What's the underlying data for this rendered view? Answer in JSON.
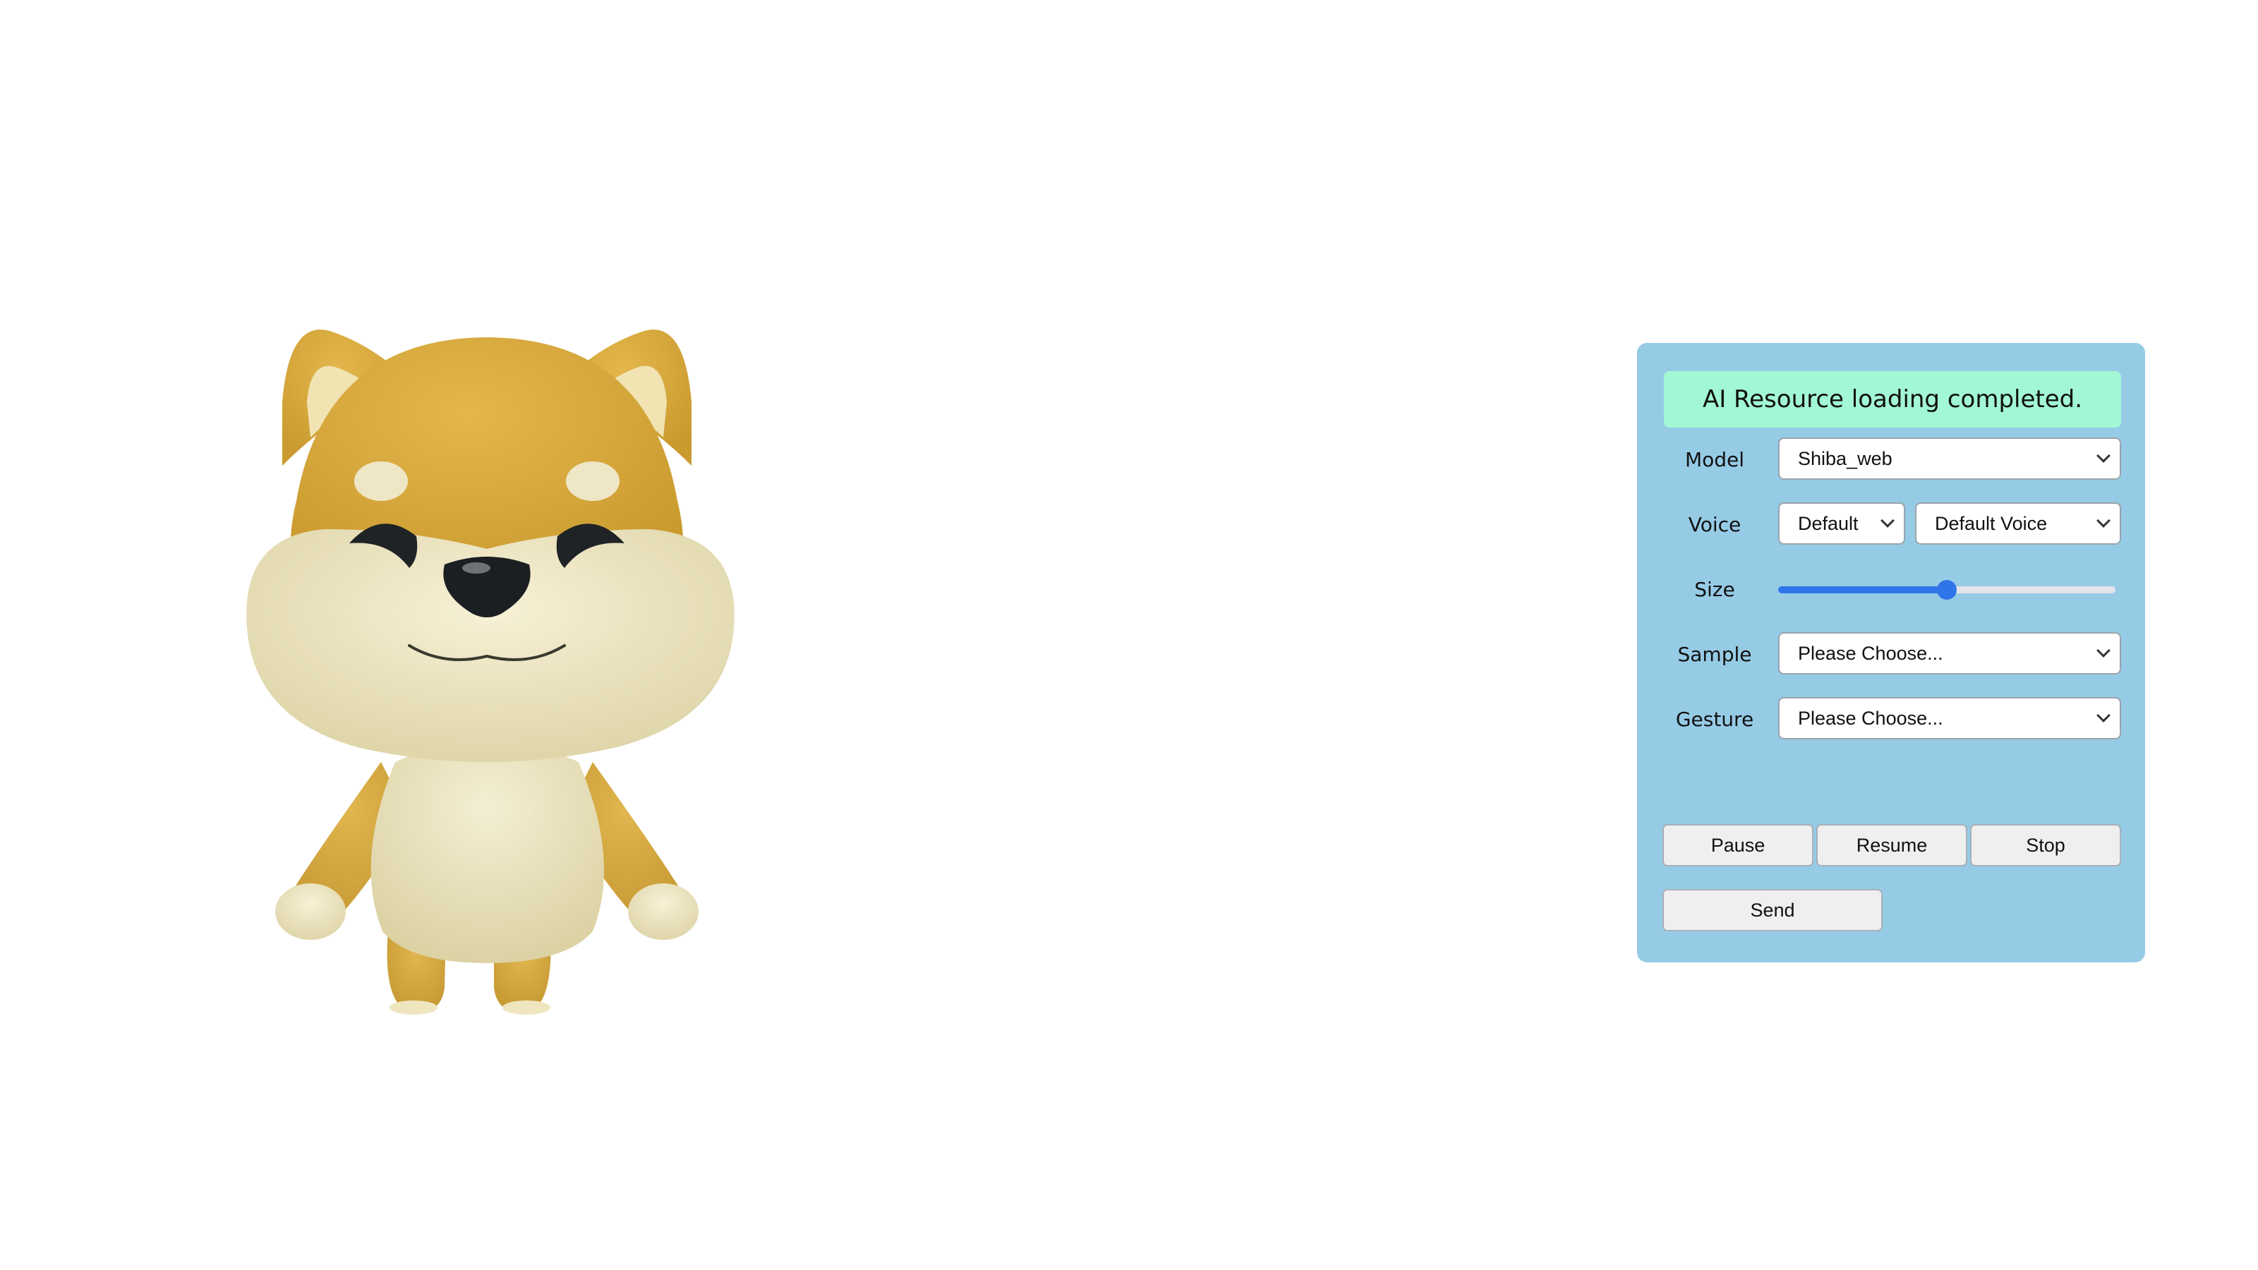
{
  "status_message": "AI Resource loading completed.",
  "colors": {
    "panel_bg": "#96cbe6",
    "status_bg": "#a2f7d4",
    "slider_accent": "#2f74e8"
  },
  "avatar": {
    "icon": "shiba-dog-3d-avatar"
  },
  "controls": {
    "model": {
      "label": "Model",
      "selected": "Shiba_web"
    },
    "voice": {
      "label": "Voice",
      "type_selected": "Default",
      "voice_selected": "Default Voice"
    },
    "size": {
      "label": "Size",
      "value_fraction": 0.5
    },
    "sample": {
      "label": "Sample",
      "selected": "Please Choose..."
    },
    "gesture": {
      "label": "Gesture",
      "selected": "Please Choose..."
    }
  },
  "buttons": {
    "pause": "Pause",
    "resume": "Resume",
    "stop": "Stop",
    "send": "Send"
  }
}
